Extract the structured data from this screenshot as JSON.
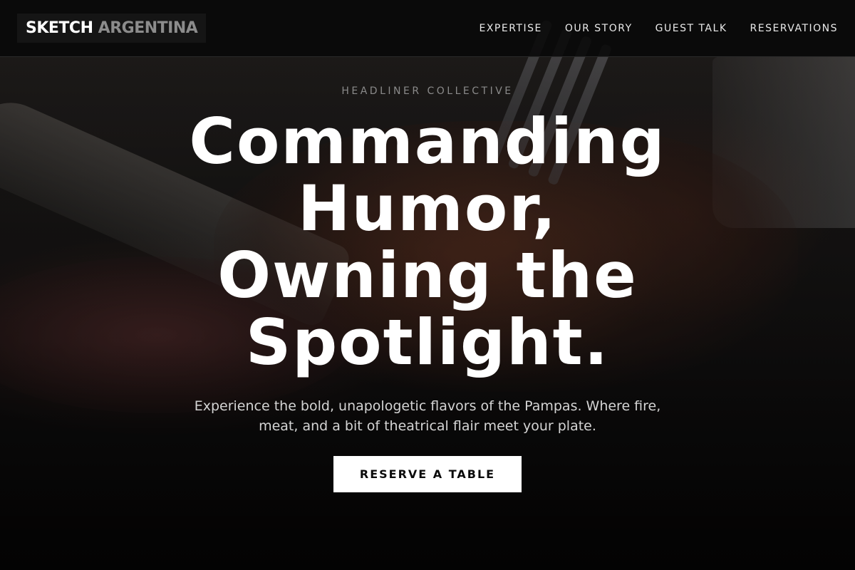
{
  "brand": {
    "name_part1": "SKETCH",
    "name_part2": "ARGENTINA"
  },
  "nav": {
    "items": [
      {
        "label": "EXPERTISE"
      },
      {
        "label": "OUR STORY"
      },
      {
        "label": "GUEST TALK"
      },
      {
        "label": "RESERVATIONS"
      }
    ]
  },
  "hero": {
    "eyebrow": "HEADLINER COLLECTIVE",
    "headline": "Commanding Humor, Owning the Spotlight.",
    "subtext": "Experience the bold, unapologetic flavors of the Pampas. Where fire, meat, and a bit of theatrical flair meet your plate.",
    "cta_label": "RESERVE A TABLE"
  },
  "colors": {
    "background": "#0d0c0b",
    "navbar": "#080808",
    "cta_background": "#ffffff",
    "cta_text": "#0a0a0a",
    "brand_accent_gray": "#8c8c8c"
  }
}
